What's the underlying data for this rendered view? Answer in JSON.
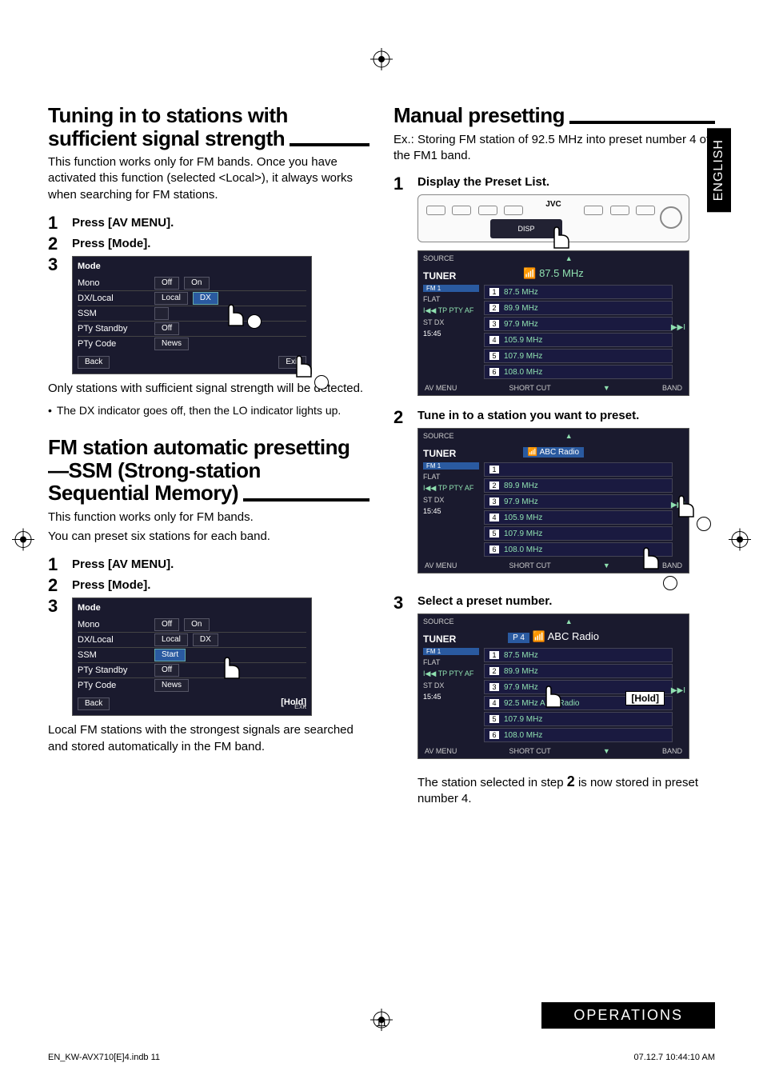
{
  "page_number": "11",
  "language_tab": "ENGLISH",
  "operations_bar": "OPERATIONS",
  "footer_left": "EN_KW-AVX710[E]4.indb   11",
  "footer_right": "07.12.7   10:44:10 AM",
  "left": {
    "section1_title_line1": "Tuning in to stations with",
    "section1_title_line2": "sufficient signal strength",
    "section1_body": "This function works only for FM bands. Once you have activated this function (selected <Local>), it always works when searching for FM stations.",
    "step1": "Press [AV MENU].",
    "step2": "Press [Mode].",
    "step3_annotation_exit": "Exit",
    "mode_panel": {
      "title": "Mode",
      "rows": [
        {
          "name": "Mono",
          "opts": [
            "Off",
            "On"
          ]
        },
        {
          "name": "DX/Local",
          "opts": [
            "Local",
            "DX"
          ],
          "sel": 1
        },
        {
          "name": "SSM",
          "opts": [
            ""
          ]
        },
        {
          "name": "PTy Standby",
          "opts": [
            "Off"
          ]
        },
        {
          "name": "PTy Code",
          "opts": [
            "News"
          ]
        }
      ],
      "back": "Back",
      "exit": "Exit"
    },
    "after_panel_1": "Only stations with sufficient signal strength will be detected.",
    "bullet_1": "The DX indicator goes off, then the LO indicator lights up.",
    "section2_title_line1": "FM station automatic presetting",
    "section2_title_line2": "—SSM (Strong-station",
    "section2_title_line3": "Sequential Memory)",
    "section2_body_1": "This function works only for FM bands.",
    "section2_body_2": "You can preset six stations for each band.",
    "s2_step1": "Press [AV MENU].",
    "s2_step2": "Press [Mode].",
    "mode_panel2": {
      "title": "Mode",
      "rows": [
        {
          "name": "Mono",
          "opts": [
            "Off",
            "On"
          ]
        },
        {
          "name": "DX/Local",
          "opts": [
            "Local",
            "DX"
          ]
        },
        {
          "name": "SSM",
          "opts": [
            "Start"
          ],
          "sel": 0
        },
        {
          "name": "PTy Standby",
          "opts": [
            "Off"
          ]
        },
        {
          "name": "PTy Code",
          "opts": [
            "News"
          ]
        }
      ],
      "back": "Back",
      "exit": "Exit",
      "hold": "[Hold]"
    },
    "section2_after": "Local FM stations with the strongest signals are searched and stored automatically in the FM band."
  },
  "right": {
    "section_title": "Manual presetting",
    "ex_text": "Ex.:  Storing FM station of 92.5 MHz into preset number 4 of the FM1 band.",
    "step1": "Display the Preset List.",
    "face": {
      "jvc": "JVC",
      "disp": "DISP"
    },
    "panel1": {
      "source": "SOURCE",
      "tuner": "TUNER",
      "fm1": "FM 1",
      "current": "87.5 MHz",
      "flat": "FLAT",
      "tp": "TP PTY AF",
      "stdx": "ST  DX",
      "time": "15:45",
      "avmenu": "AV MENU",
      "shortcut": "SHORT CUT",
      "band": "BAND",
      "presets": [
        {
          "n": "1",
          "f": "87.5 MHz"
        },
        {
          "n": "2",
          "f": "89.9 MHz"
        },
        {
          "n": "3",
          "f": "97.9 MHz"
        },
        {
          "n": "4",
          "f": "105.9 MHz"
        },
        {
          "n": "5",
          "f": "107.9 MHz"
        },
        {
          "n": "6",
          "f": "108.0 MHz"
        }
      ]
    },
    "step2": "Tune in to a station you want to preset.",
    "panel2": {
      "source": "SOURCE",
      "tuner": "TUNER",
      "fm1": "FM 1",
      "station": "ABC Radio",
      "flat": "FLAT",
      "tp": "TP PTY AF",
      "stdx": "ST  DX",
      "time": "15:45",
      "avmenu": "AV MENU",
      "shortcut": "SHORT CUT",
      "band": "BAND",
      "presets": [
        {
          "n": "1",
          "f": ""
        },
        {
          "n": "2",
          "f": "89.9 MHz"
        },
        {
          "n": "3",
          "f": "97.9 MHz"
        },
        {
          "n": "4",
          "f": "105.9 MHz"
        },
        {
          "n": "5",
          "f": "107.9 MHz"
        },
        {
          "n": "6",
          "f": "108.0 MHz"
        }
      ]
    },
    "step3": "Select a preset number.",
    "panel3": {
      "source": "SOURCE",
      "tuner": "TUNER",
      "fm1": "FM 1",
      "station": "ABC Radio",
      "p4": "P 4",
      "flat": "FLAT",
      "tp": "TP PTY AF",
      "stdx": "ST  DX",
      "time": "15:45",
      "avmenu": "AV MENU",
      "shortcut": "SHORT CUT",
      "band": "BAND",
      "hold": "[Hold]",
      "presets": [
        {
          "n": "1",
          "f": "87.5 MHz"
        },
        {
          "n": "2",
          "f": "89.9 MHz"
        },
        {
          "n": "3",
          "f": "97.9 MHz"
        },
        {
          "n": "4",
          "f": "92.5 MHz  ABC Radio"
        },
        {
          "n": "5",
          "f": "107.9 MHz"
        },
        {
          "n": "6",
          "f": "108.0 MHz"
        }
      ]
    },
    "after_step3_a": "The station selected in step ",
    "after_step3_num": "2",
    "after_step3_b": " is now stored in preset number 4."
  }
}
